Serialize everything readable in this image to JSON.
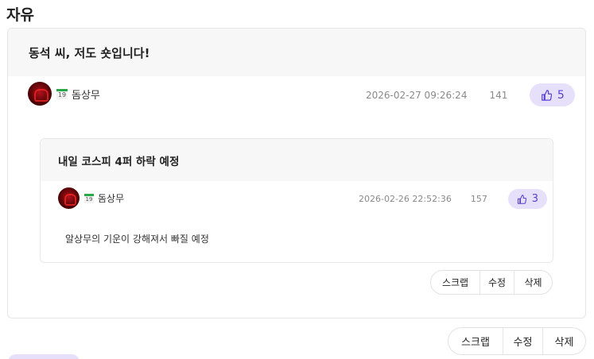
{
  "board": {
    "title": "자유"
  },
  "post": {
    "title": "동석 씨, 저도 숏입니다!",
    "level": "19",
    "author": "돔상무",
    "datetime": "2026-02-27 09:26:24",
    "views": "141",
    "likes": "5",
    "buttons": {
      "scrap": "스크랩",
      "edit": "수정",
      "delete": "삭제"
    }
  },
  "quoted_post": {
    "title": "내일 코스피 4퍼 하락 예정",
    "level": "19",
    "author": "돔상무",
    "datetime": "2026-02-26 22:52:36",
    "views": "157",
    "likes": "3",
    "body": "알상무의 기운이 강해져서 빠질 예정",
    "buttons": {
      "scrap": "스크랩",
      "edit": "수정",
      "delete": "삭제"
    }
  },
  "colors": {
    "accent": "#5a3fd1",
    "like_bg": "#e6e0fb",
    "level_badge": "#27a844"
  }
}
